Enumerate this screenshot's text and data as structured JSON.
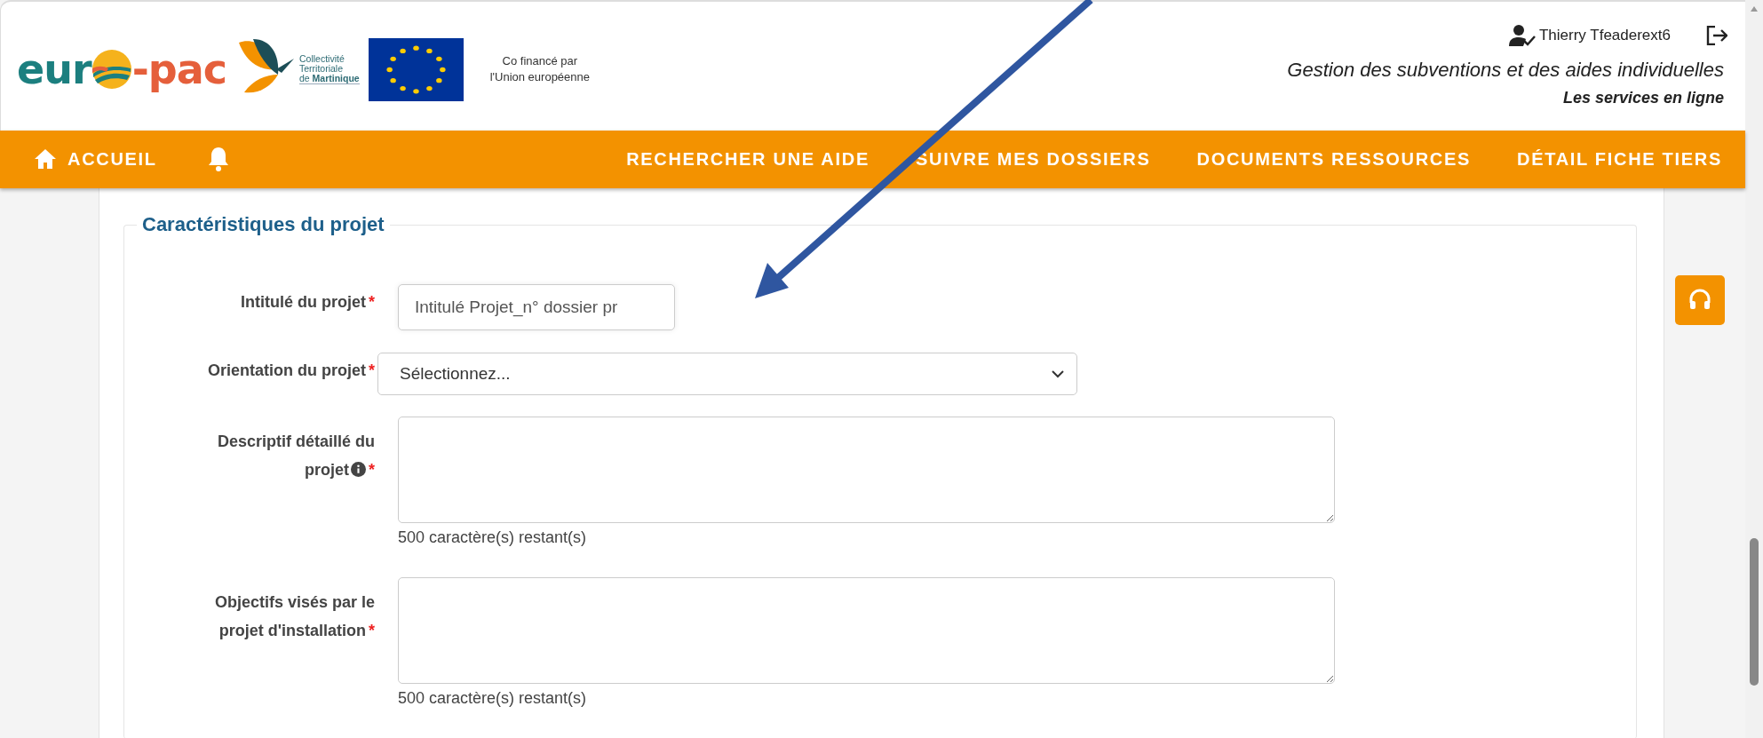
{
  "logo": {
    "prefix": "eur",
    "suffix": "-pac"
  },
  "ctm_logo": {
    "lines": [
      "Collectivité",
      "Territoriale"
    ],
    "place": "de **Martinique**"
  },
  "eu_notice": [
    "Co financé par",
    "l'Union européenne"
  ],
  "user": {
    "name": "Thierry Tfeaderext6"
  },
  "site_title": "Gestion des subventions et des aides individuelles",
  "site_subtitle": "Les services en ligne",
  "nav": {
    "home": "ACCUEIL",
    "items": [
      "RECHERCHER UNE AIDE",
      "SUIVRE MES DOSSIERS",
      "DOCUMENTS RESSOURCES",
      "DÉTAIL FICHE TIERS"
    ]
  },
  "section": {
    "title": "Caractéristiques du projet",
    "fields": [
      {
        "kind": "text",
        "label": "Intitulé du projet",
        "asterisk": "*",
        "info": false,
        "value": "Intitulé Projet_n° dossier pr"
      },
      {
        "kind": "select",
        "label": "Orientation du projet",
        "asterisk": "*",
        "info": false,
        "value": "Sélectionnez..."
      },
      {
        "kind": "textarea",
        "label": "Descriptif détaillé du projet",
        "asterisk": "*",
        "info": true,
        "counter": "500 caractère(s) restant(s)"
      },
      {
        "kind": "textarea",
        "label": "Objectifs visés par le projet d'installation",
        "asterisk": "*",
        "info": false,
        "counter": "500 caractère(s) restant(s)"
      }
    ]
  }
}
